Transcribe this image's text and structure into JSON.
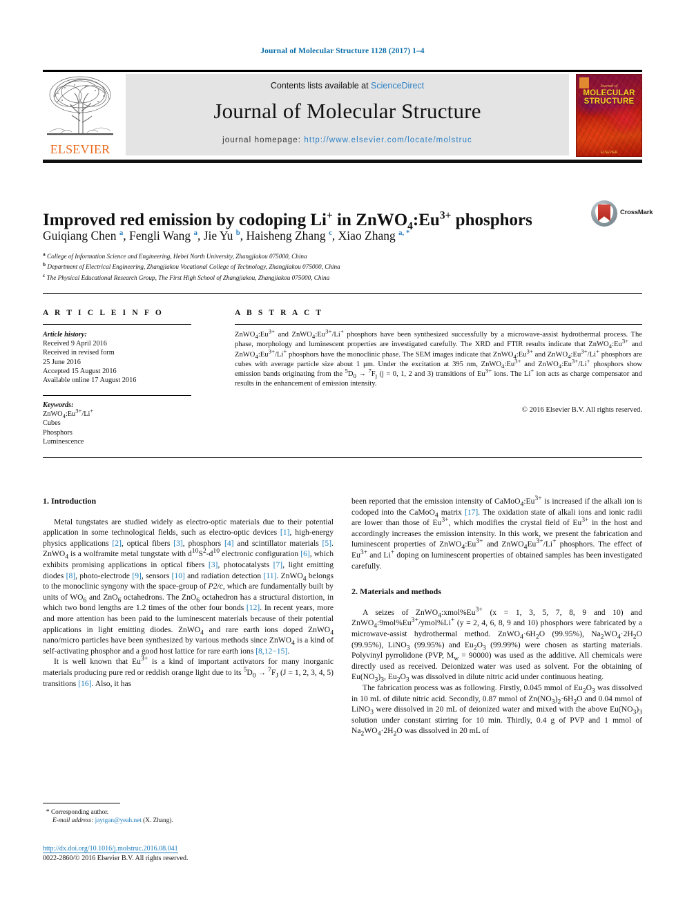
{
  "running_head": "Journal of Molecular Structure 1128 (2017) 1–4",
  "masthead": {
    "contents_prefix": "Contents lists available at ",
    "sciencedirect": "ScienceDirect",
    "journal_name": "Journal of Molecular Structure",
    "homepage_prefix": "journal homepage: ",
    "homepage_url": "http://www.elsevier.com/locate/molstruc",
    "publisher": "ELSEVIER",
    "cover": {
      "journal_of": "Journal of",
      "line1": "MOLECULAR",
      "line2": "STRUCTURE",
      "footer": "ELSEVIER"
    }
  },
  "article": {
    "title_html": "Improved red emission by codoping Li<sup>+</sup> in ZnWO<sub>4</sub>:Eu<sup>3+</sup> phosphors",
    "crossmark_label": "CrossMark",
    "authors_html": "Guiqiang Chen <sup class=\"aff-mark\">a</sup>, Fengli Wang <sup class=\"aff-mark\">a</sup>, Jie Yu <sup class=\"aff-mark\">b</sup>, Haisheng Zhang <sup class=\"aff-mark\">c</sup>, Xiao Zhang <sup class=\"aff-mark\">a, *</sup>",
    "affiliations": [
      {
        "mark": "a",
        "text": "College of Information Science and Engineering, Hebei North University, Zhangjiakou 075000, China"
      },
      {
        "mark": "b",
        "text": "Department of Electrical Engineering, Zhangjiakou Vocational College of Technology, Zhangjiakou 075000, China"
      },
      {
        "mark": "c",
        "text": "The Physical Educational Research Group, The First High School of Zhangjiakou, Zhangjiakou 075000, China"
      }
    ]
  },
  "info_column": {
    "heading": "A R T I C L E   I N F O",
    "history_label": "Article history:",
    "history": [
      "Received 9 April 2016",
      "Received in revised form",
      "25 June 2016",
      "Accepted 15 August 2016",
      "Available online 17 August 2016"
    ],
    "keywords_label": "Keywords:",
    "keywords_html": [
      "ZnWO<sub>4</sub>:Eu<sup>3+</sup>/Li<sup>+</sup>",
      "Cubes",
      "Phosphors",
      "Luminescence"
    ]
  },
  "abstract": {
    "heading": "A B S T R A C T",
    "text_html": "ZnWO<sub>4</sub>:Eu<sup>3+</sup> and ZnWO<sub>4</sub>:Eu<sup>3+</sup>/Li<sup>+</sup> phosphors have been synthesized successfully by a microwave-assist hydrothermal process. The phase, morphology and luminescent properties are investigated carefully. The XRD and FTIR results indicate that ZnWO<sub>4</sub>:Eu<sup>3+</sup> and ZnWO<sub>4</sub>:Eu<sup>3+</sup>/Li<sup>+</sup> phosphors have the monoclinic phase. The SEM images indicate that ZnWO<sub>4</sub>:Eu<sup>3+</sup> and ZnWO<sub>4</sub>:Eu<sup>3+</sup>/Li<sup>+</sup> phosphors are cubes with average particle size about 1 &mu;m. Under the excitation at 395 nm, ZnWO<sub>4</sub>:Eu<sup>3+</sup> and ZnWO<sub>4</sub>:Eu<sup>3+</sup>/Li<sup>+</sup> phosphors show emission bands originating from the <sup>5</sup>D<sub>0</sub> &rarr; <sup>7</sup>F<sub>j</sub> (j = 0, 1, 2 and 3) transitions of Eu<sup>3+</sup> ions. The Li<sup>+</sup> ion acts as charge compensator and results in the enhancement of emission intensity.",
    "copyright": "© 2016 Elsevier B.V. All rights reserved."
  },
  "body": {
    "intro_heading": "1.  Introduction",
    "intro_p1_html": "Metal tungstates are studied widely as electro-optic materials due to their potential application in some technological fields, such as electro-optic devices <span class=\"ref\">[1]</span>, high-energy physics applications <span class=\"ref\">[2]</span>, optical fibers <span class=\"ref\">[3]</span>, phosphors <span class=\"ref\">[4]</span> and scintillator materials <span class=\"ref\">[5]</span>. ZnWO<sub>4</sub> is a wolframite metal tungstate with d<sup>10</sup>S<sup>2</sup>-d<sup>10</sup> electronic configuration <span class=\"ref\">[6]</span>, which exhibits promising applications in optical fibers <span class=\"ref\">[3]</span>, photocatalysts <span class=\"ref\">[7]</span>, light emitting diodes <span class=\"ref\">[8]</span>, photo-electrode <span class=\"ref\">[9]</span>, sensors <span class=\"ref\">[10]</span> and radiation detection <span class=\"ref\">[11]</span>. ZnWO<sub>4</sub> belongs to the monoclinic syngony with the space-group of <i>P2/c</i>, which are fundamentally built by units of WO<sub>6</sub> and ZnO<sub>6</sub> octahedrons. The ZnO<sub>6</sub> octahedron has a structural distortion, in which two bond lengths are 1.2 times of the other four bonds <span class=\"ref\">[12]</span>. In recent years, more and more attention has been paid to the luminescent materials because of their potential applications in light emitting diodes. ZnWO<sub>4</sub> and rare earth ions doped ZnWO<sub>4</sub> nano/micro particles have been synthesized by various methods since ZnWO<sub>4</sub> is a kind of self-activating phosphor and a good host lattice for rare earth ions <span class=\"ref\">[8,12&minus;15]</span>.",
    "intro_p2_html": "It is well known that Eu<sup>3+</sup> is a kind of important activators for many inorganic materials producing pure red or reddish orange light due to its <sup>5</sup>D<sub>0</sub> &rarr; <sup>7</sup>F<sub>J</sub> (J = 1, 2, 3, 4, 5) transitions <span class=\"ref\">[16]</span>. Also, it has",
    "intro_p3_html": "been reported that the emission intensity of CaMoO<sub>4</sub>:Eu<sup>3+</sup> is increased if the alkali ion is codoped into the CaMoO<sub>4</sub> matrix <span class=\"ref\">[17]</span>. The oxidation state of alkali ions and ionic radii are lower than those of Eu<sup>3+</sup>, which modifies the crystal field of Eu<sup>3+</sup> in the host and accordingly increases the emission intensity. In this work, we present the fabrication and luminescent properties of ZnWO<sub>4</sub>:Eu<sup>3+</sup> and ZnWO<sub>4</sub>Eu<sup>3+</sup>/Li<sup>+</sup> phosphors. The effect of Eu<sup>3+</sup> and Li<sup>+</sup> doping on luminescent properties of obtained samples has been investigated carefully.",
    "methods_heading": "2.  Materials and methods",
    "methods_p1_html": "A seizes of ZnWO<sub>4</sub>:xmol%Eu<sup>3+</sup> (x = 1, 3, 5, 7, 8, 9 and 10) and ZnWO<sub>4</sub>:9mol%Eu<sup>3+</sup>/ymol%Li<sup>+</sup> (y = 2, 4, 6, 8, 9 and 10) phosphors were fabricated by a microwave-assist hydrothermal method. ZnWO<sub>4</sub>&middot;6H<sub>2</sub>O (99.95%), Na<sub>2</sub>WO<sub>4</sub>&middot;2H<sub>2</sub>O (99.95%), LiNO<sub>3</sub> (99.95%) and Eu<sub>2</sub>O<sub>3</sub> (99.99%) were chosen as starting materials. Polyvinyl pyrrolidone (PVP, M<sub>w</sub> = 90000) was used as the additive. All chemicals were directly used as received. Deionized water was used as solvent. For the obtaining of Eu(NO<sub>3</sub>)<sub>3</sub>, Eu<sub>2</sub>O<sub>3</sub> was dissolved in dilute nitric acid under continuous heating.",
    "methods_p2_html": "The fabrication process was as following. Firstly, 0.045 mmol of Eu<sub>2</sub>O<sub>3</sub> was dissolved in 10 mL of dilute nitric acid. Secondly, 0.87 mmol of Zn(NO<sub>3</sub>)<sub>2</sub>&middot;6H<sub>2</sub>O and 0.04 mmol of LiNO<sub>3</sub> were dissolved in 20 mL of deionized water and mixed with the above Eu(NO<sub>3</sub>)<sub>3</sub> solution under constant stirring for 10 min. Thirdly, 0.4 g of PVP and 1 mmol of Na<sub>2</sub>WO<sub>4</sub>&middot;2H<sub>2</sub>O was dissolved in 20 mL of"
  },
  "footer": {
    "corresponding_star": "*",
    "corresponding_label": "Corresponding author.",
    "email_label": "E-mail address:",
    "email": "jaytgan@yeah.net",
    "email_suffix": "(X. Zhang).",
    "doi": "http://dx.doi.org/10.1016/j.molstruc.2016.08.041",
    "issn_line": "0022-2860/© 2016 Elsevier B.V. All rights reserved."
  }
}
